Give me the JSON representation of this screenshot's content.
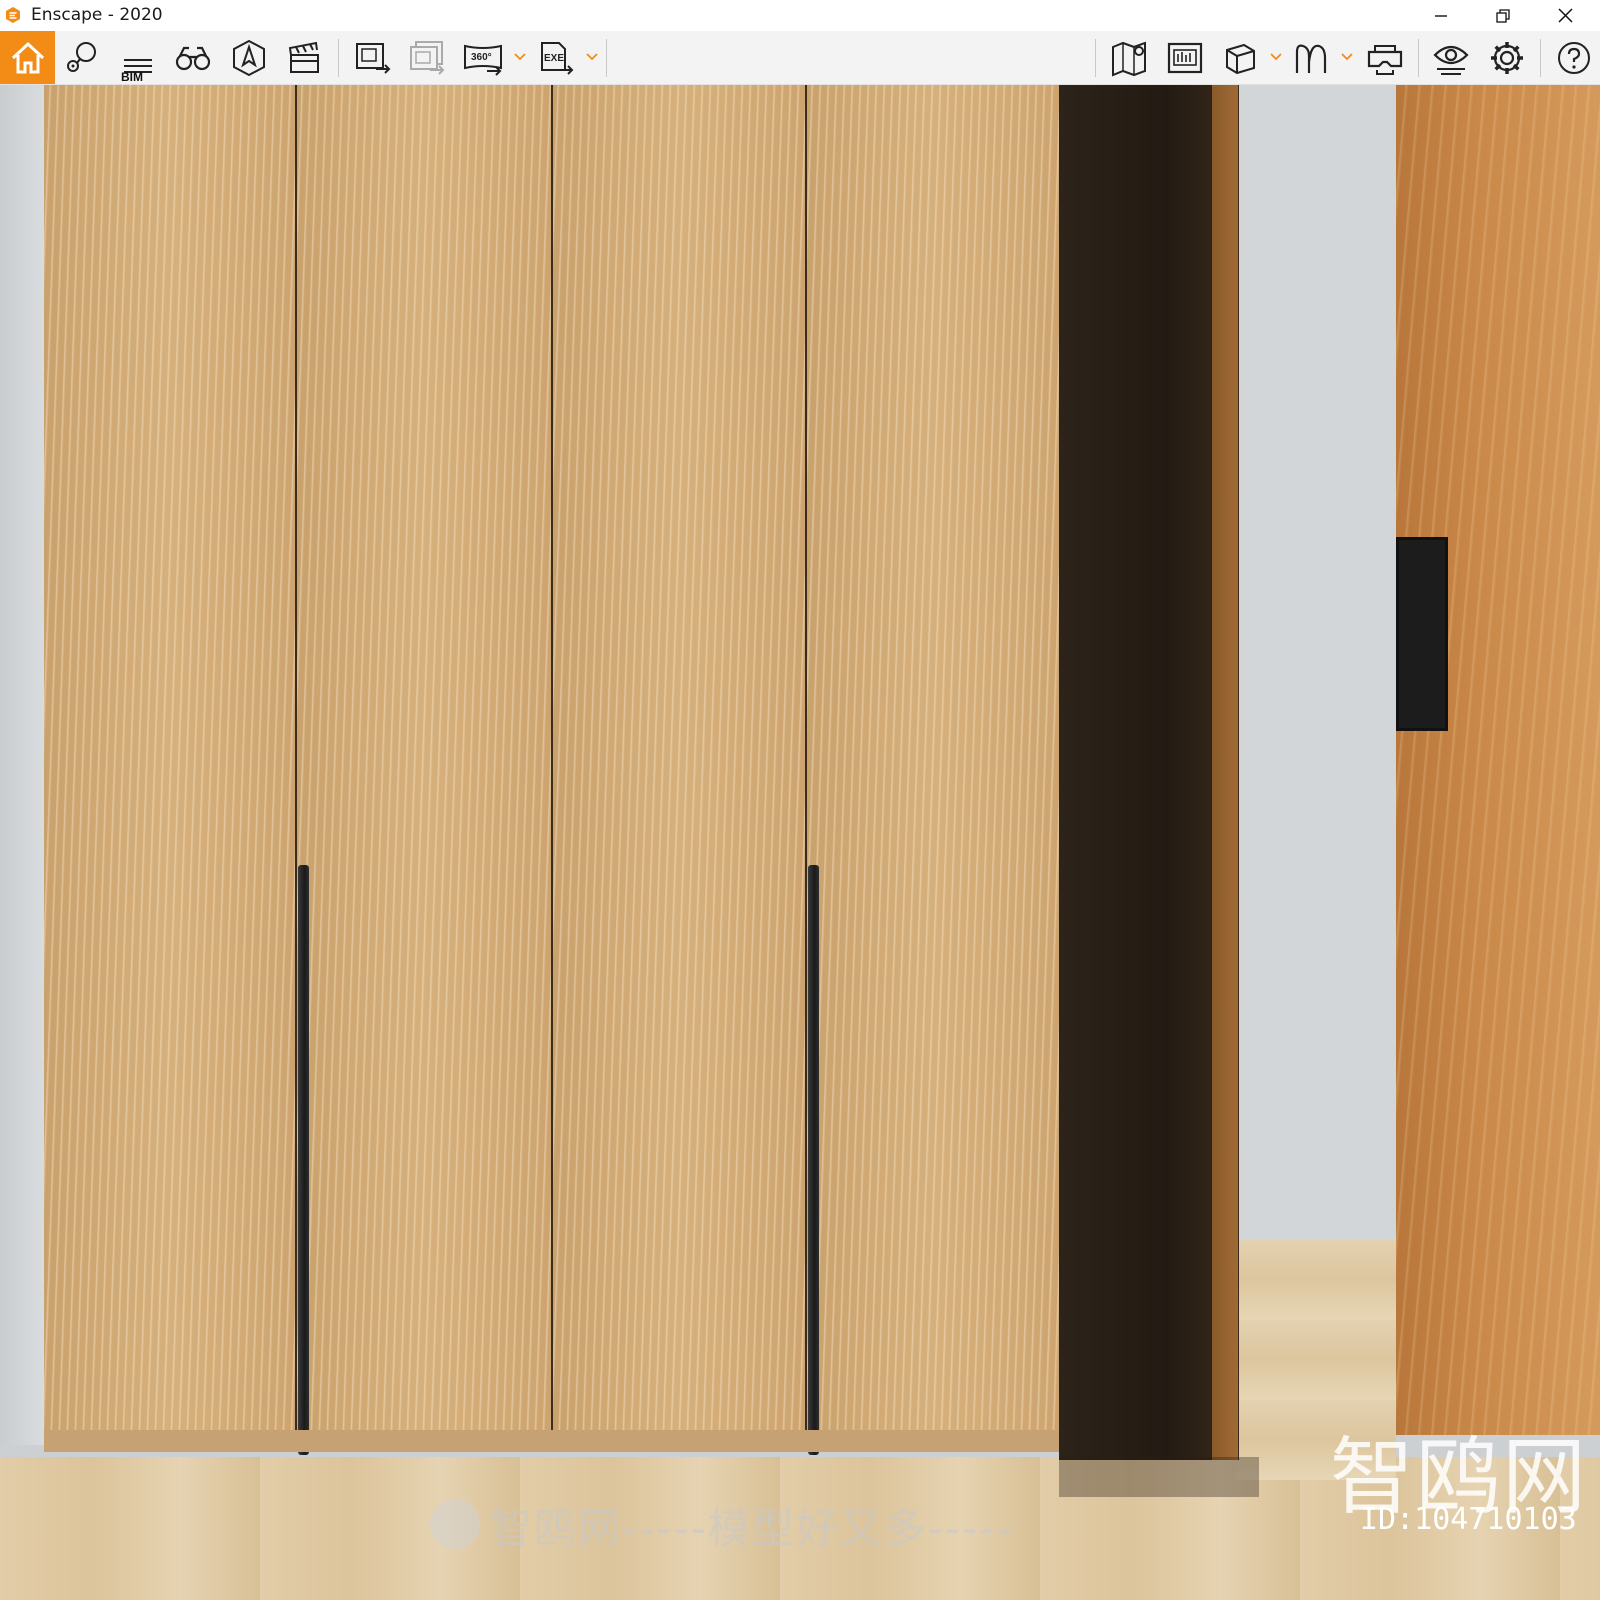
{
  "window": {
    "title": "Enscape - 2020",
    "brand_color": "#f28c16"
  },
  "toolbar": {
    "home": {
      "icon": "home-icon"
    },
    "left_group": [
      {
        "name": "location-favorites",
        "icon": "favorites-location-icon"
      },
      {
        "name": "bim",
        "icon": "bim-icon",
        "label": "BIM"
      },
      {
        "name": "binoculars",
        "icon": "binoculars-icon"
      },
      {
        "name": "sun-direction",
        "icon": "compass-sun-icon"
      },
      {
        "name": "video-editor",
        "icon": "clapperboard-icon"
      }
    ],
    "export_group": [
      {
        "name": "export-image",
        "icon": "export-image-icon"
      },
      {
        "name": "batch-render",
        "icon": "batch-render-icon"
      },
      {
        "name": "export-panorama",
        "icon": "panorama-360-icon",
        "label": "360°",
        "dropdown": true
      },
      {
        "name": "export-exe",
        "icon": "export-exe-icon",
        "label": "EXE",
        "dropdown": true
      }
    ],
    "right_group": [
      {
        "name": "map",
        "icon": "map-pin-icon"
      },
      {
        "name": "asset-library",
        "icon": "asset-library-icon"
      },
      {
        "name": "material-editor",
        "icon": "cube-icon",
        "dropdown": true
      },
      {
        "name": "views",
        "icon": "views-icon",
        "dropdown": true
      },
      {
        "name": "vr-headset",
        "icon": "vr-headset-icon"
      }
    ],
    "settings_group": [
      {
        "name": "visual-settings",
        "icon": "eye-settings-icon"
      },
      {
        "name": "general-settings",
        "icon": "gear-icon"
      },
      {
        "name": "help",
        "icon": "help-icon"
      }
    ]
  },
  "viewport": {
    "watermark_main": "智鸥网",
    "watermark_id": "ID:104710103",
    "watermark_slogan": "智鸥网-----模型好又多-----"
  }
}
